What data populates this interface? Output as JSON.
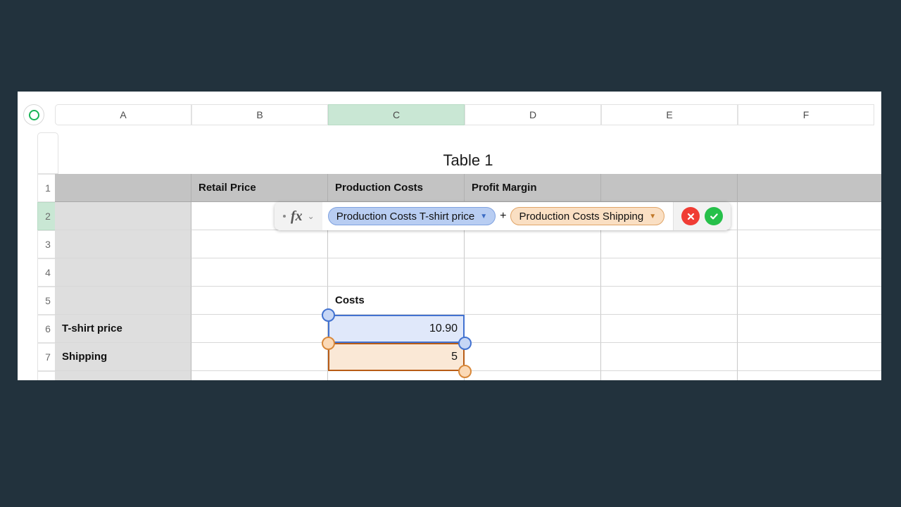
{
  "app": {
    "corner_icon": "circle-outline-icon",
    "accent_green": "#18b355",
    "selected_header_bg": "#c9e7d4"
  },
  "columns": [
    {
      "label": "A",
      "selected": false
    },
    {
      "label": "B",
      "selected": false
    },
    {
      "label": "C",
      "selected": true
    },
    {
      "label": "D",
      "selected": false
    },
    {
      "label": "E",
      "selected": false
    },
    {
      "label": "F",
      "selected": false
    }
  ],
  "rows": [
    {
      "label": "1",
      "selected": false
    },
    {
      "label": "2",
      "selected": true
    },
    {
      "label": "3",
      "selected": false
    },
    {
      "label": "4",
      "selected": false
    },
    {
      "label": "5",
      "selected": false
    },
    {
      "label": "6",
      "selected": false
    },
    {
      "label": "7",
      "selected": false
    }
  ],
  "table": {
    "title": "Table 1",
    "header_row": [
      "",
      "Retail Price",
      "Production Costs",
      "Profit Margin",
      "",
      ""
    ],
    "row_labels": [
      "",
      "",
      "",
      "",
      "T-shirt price",
      "Shipping"
    ],
    "cells": {
      "c5_label": "Costs",
      "c6_value": "10.90",
      "c7_value": "5"
    }
  },
  "formula_editor": {
    "fx_label": "fx",
    "fx_chevron": "⌄",
    "tokens": [
      {
        "text": "Production Costs T-shirt price",
        "color": "blue",
        "caret": "▼"
      },
      {
        "text": "Production Costs Shipping",
        "color": "orange",
        "caret": "▼"
      }
    ],
    "operator": "+",
    "cancel_glyph": "✕",
    "accept_glyph": "✓",
    "cancel_color": "#f03c34",
    "accept_color": "#26c04a"
  },
  "selection": {
    "active_cell_border": "#1b8a3e",
    "blue_range_border": "#4272d0",
    "orange_range_border": "#b85c16"
  }
}
